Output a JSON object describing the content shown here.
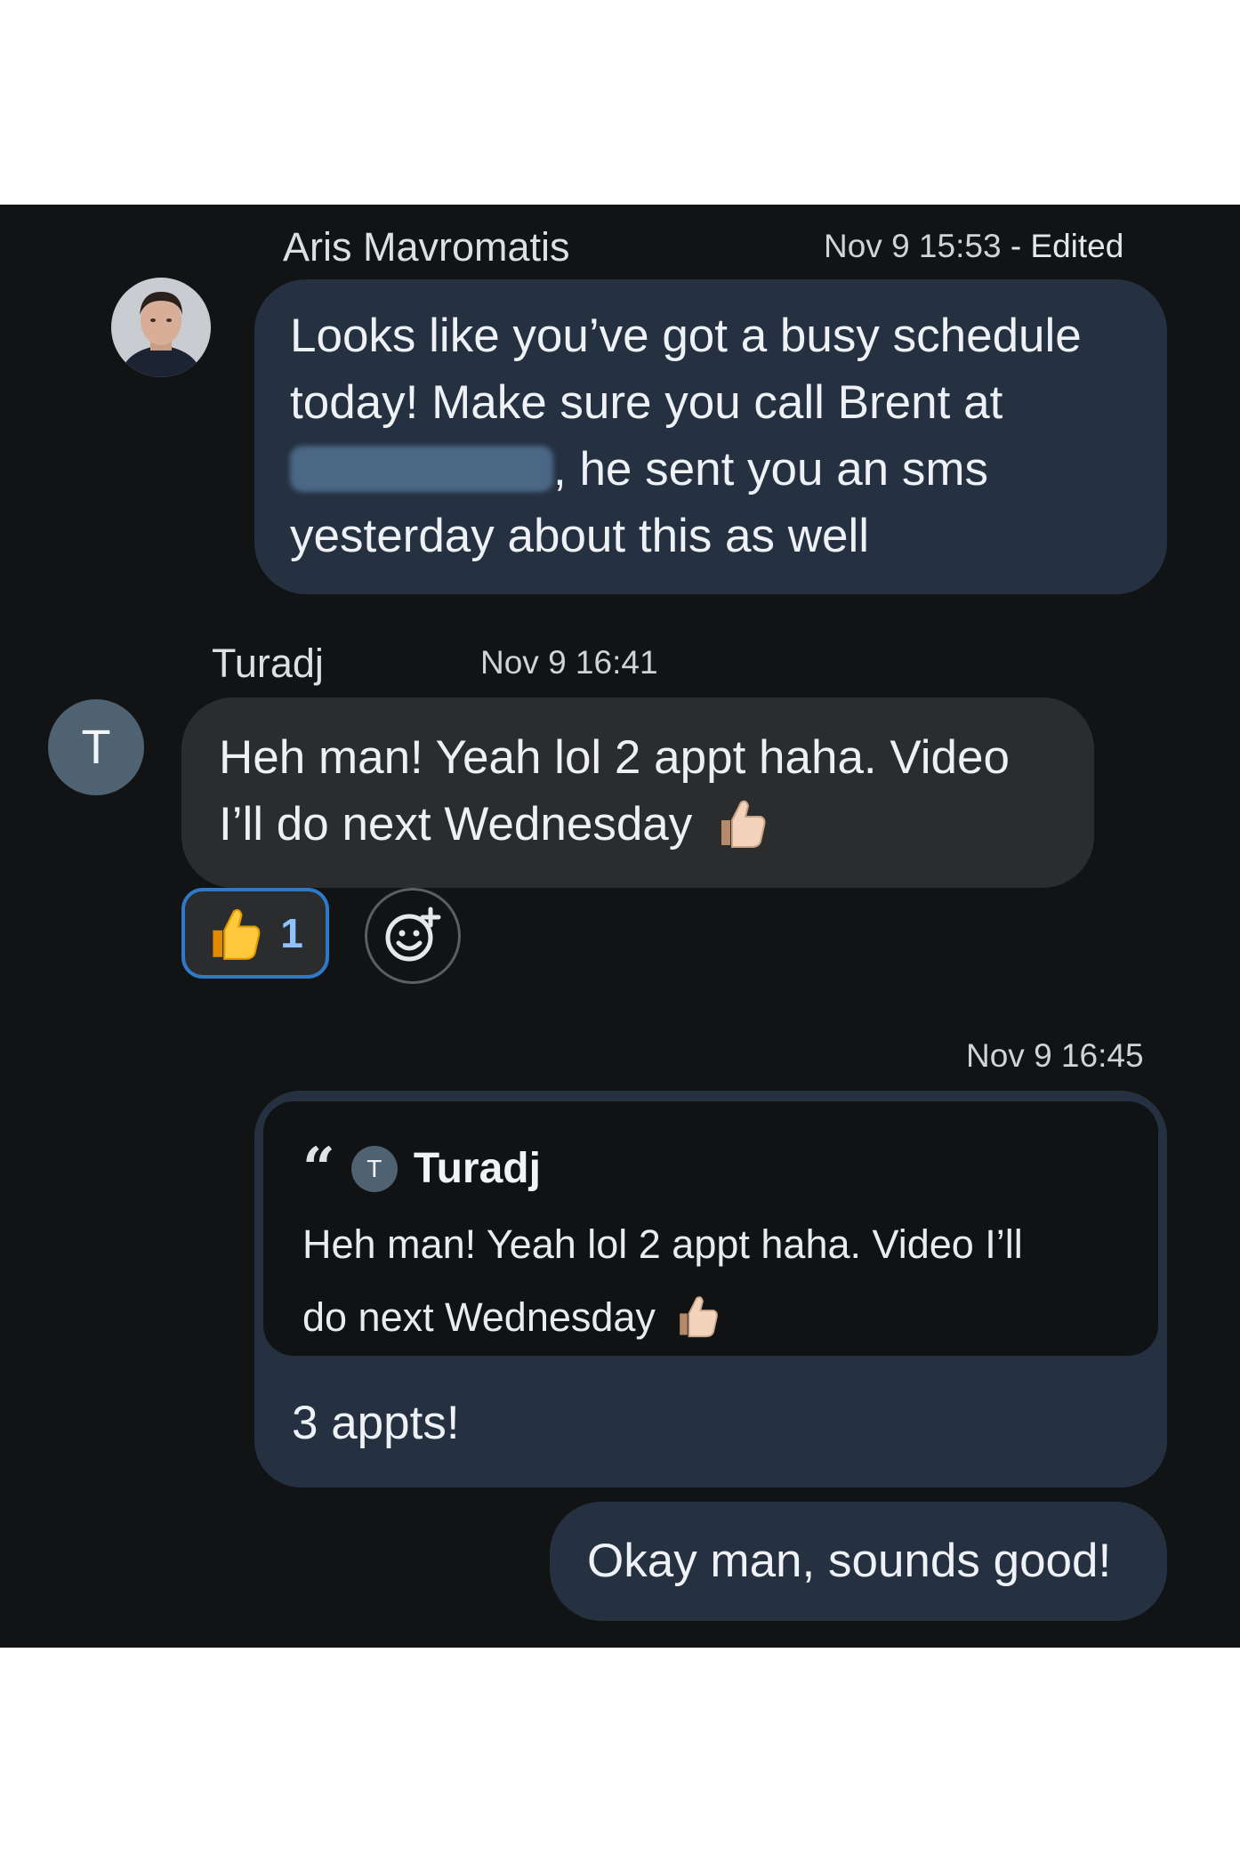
{
  "messages": [
    {
      "sender": "Aris Mavromatis",
      "time": "Nov 9 15:53",
      "edited_label": "- Edited",
      "text_line1": "Looks like you’ve got a busy schedule",
      "text_line2": "today! Make sure you  call Brent at",
      "text_line3": ", he sent you an sms",
      "text_line4": "yesterday about this as well"
    },
    {
      "sender": "Turadj",
      "avatar_letter": "T",
      "time": "Nov 9 16:41",
      "text_line1": "Heh man! Yeah lol 2 appt haha. Video",
      "text_line2": "I’ll do next Wednesday",
      "reaction_count": "1"
    },
    {
      "time": "Nov 9 16:45",
      "quote_author": "Turadj",
      "quote_avatar_letter": "T",
      "quote_line1": "Heh man! Yeah lol 2 appt haha. Video I’ll",
      "quote_line2": "do next Wednesday",
      "text": "3 appts!"
    },
    {
      "text": "Okay man, sounds good!"
    }
  ],
  "icons": {
    "thumbs_up": "thumbs-up-icon",
    "add_reaction": "add-reaction-icon",
    "quote": "quote-icon"
  },
  "colors": {
    "chat_bg": "#121314",
    "outgoing_bubble": "#253140",
    "incoming_bubble": "#2b2c2e",
    "reaction_border": "#2f79c9"
  }
}
